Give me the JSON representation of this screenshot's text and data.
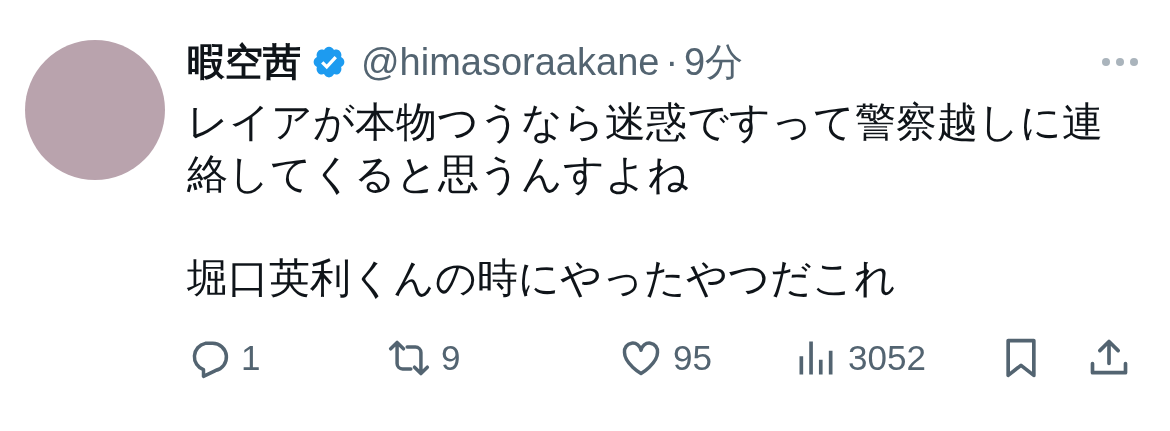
{
  "author": {
    "name": "暇空茜",
    "verified": true,
    "handle": "@himasoraakane",
    "separator": "·",
    "time": "9分"
  },
  "paragraphs": [
    "レイアが本物つうなら迷惑ですって警察越しに連絡してくると思うんすよね",
    "堀口英利くんの時にやったやつだこれ"
  ],
  "actions": [
    {
      "kind": "reply",
      "count": "1"
    },
    {
      "kind": "repost",
      "count": "9"
    },
    {
      "kind": "like",
      "count": "95"
    },
    {
      "kind": "views",
      "count": "3052"
    },
    {
      "kind": "bookmark"
    },
    {
      "kind": "share"
    }
  ]
}
